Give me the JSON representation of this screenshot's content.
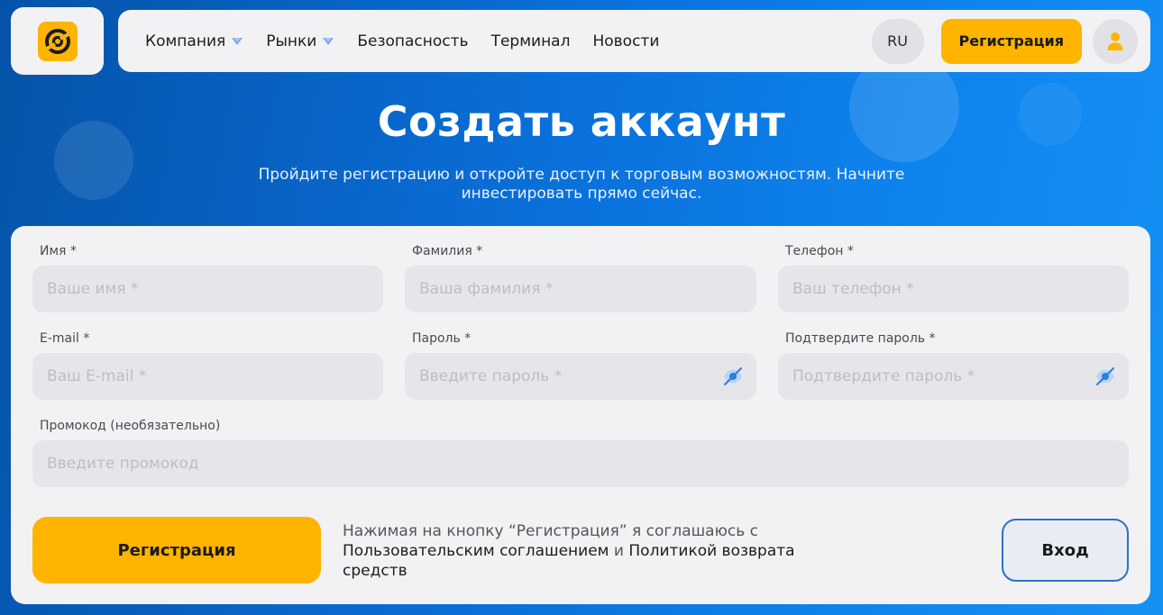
{
  "header": {
    "nav": [
      {
        "label": "Компания",
        "has_dropdown": true
      },
      {
        "label": "Рынки",
        "has_dropdown": true
      },
      {
        "label": "Безопасность",
        "has_dropdown": false
      },
      {
        "label": "Терминал",
        "has_dropdown": false
      },
      {
        "label": "Новости",
        "has_dropdown": false
      }
    ],
    "language": "RU",
    "register_label": "Регистрация",
    "user_icon": "user-icon"
  },
  "hero": {
    "title": "Создать аккаунт",
    "subtitle": "Пройдите регистрацию и откройте доступ к торговым возможностям. Начните инвестировать прямо сейчас."
  },
  "form": {
    "first_name": {
      "label": "Имя *",
      "placeholder": "Ваше имя *",
      "value": ""
    },
    "last_name": {
      "label": "Фамилия *",
      "placeholder": "Ваша фамилия *",
      "value": ""
    },
    "phone": {
      "label": "Телефон *",
      "placeholder": "Ваш телефон *",
      "value": ""
    },
    "email": {
      "label": "E-mail *",
      "placeholder": "Ваш E-mail *",
      "value": ""
    },
    "password": {
      "label": "Пароль *",
      "placeholder": "Введите пароль *",
      "value": ""
    },
    "confirm_password": {
      "label": "Подтвердите пароль *",
      "placeholder": "Подтвердите пароль *",
      "value": ""
    },
    "promo": {
      "label": "Промокод (необязательно)",
      "placeholder": "Введите промокод",
      "value": ""
    },
    "submit_label": "Регистрация",
    "agreement": {
      "prefix": "Нажимая на кнопку “Регистрация” я соглашаюсь с",
      "terms_link": "Пользовательским соглашением",
      "conjunction": "и",
      "refund_link": "Политикой возврата средств"
    },
    "login_label": "Вход"
  },
  "colors": {
    "accent": "#ffb400",
    "background_start": "#0553a8",
    "background_end": "#1591f5",
    "card": "#f2f2f4",
    "input": "#e6e6ea",
    "login_border": "#2b72c9",
    "eye_icon": "#2b7de0"
  }
}
